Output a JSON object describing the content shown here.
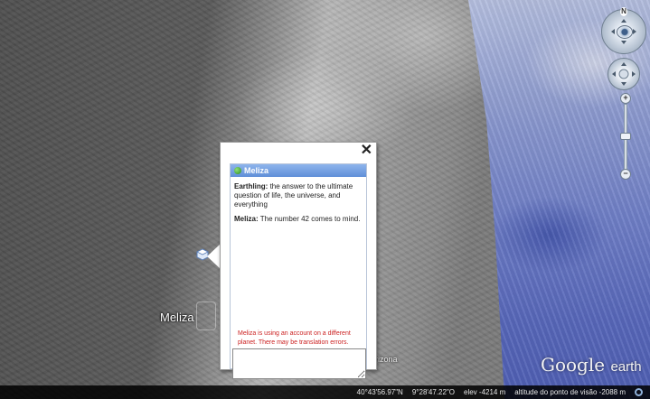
{
  "balloon": {
    "contact_name": "Meliza",
    "close_glyph": "✕",
    "messages": [
      {
        "sender": "Earthling:",
        "text": "the answer to the ultimate question of life, the universe, and everything"
      },
      {
        "sender": "Meliza:",
        "text": "The number 42 comes to mind."
      }
    ],
    "warning": "Meliza is using an account on a different planet. There may be translation errors.",
    "input_value": "",
    "status_color": "#2c8a1c"
  },
  "map": {
    "placemark_label": "Meliza",
    "background_label_fragment": "rizona",
    "placemark_icon": "placemark-icon"
  },
  "nav": {
    "north_label": "N",
    "zoom_in_label": "+",
    "zoom_out_label": "−"
  },
  "logo": {
    "google": "Google",
    "earth": "earth"
  },
  "status_bar": {
    "latitude": "40°43'56.97\"N",
    "longitude": "9°28'47.22\"O",
    "elevation": "elev -4214 m",
    "altitude": "altitude do ponto de visão  -2088 m"
  }
}
